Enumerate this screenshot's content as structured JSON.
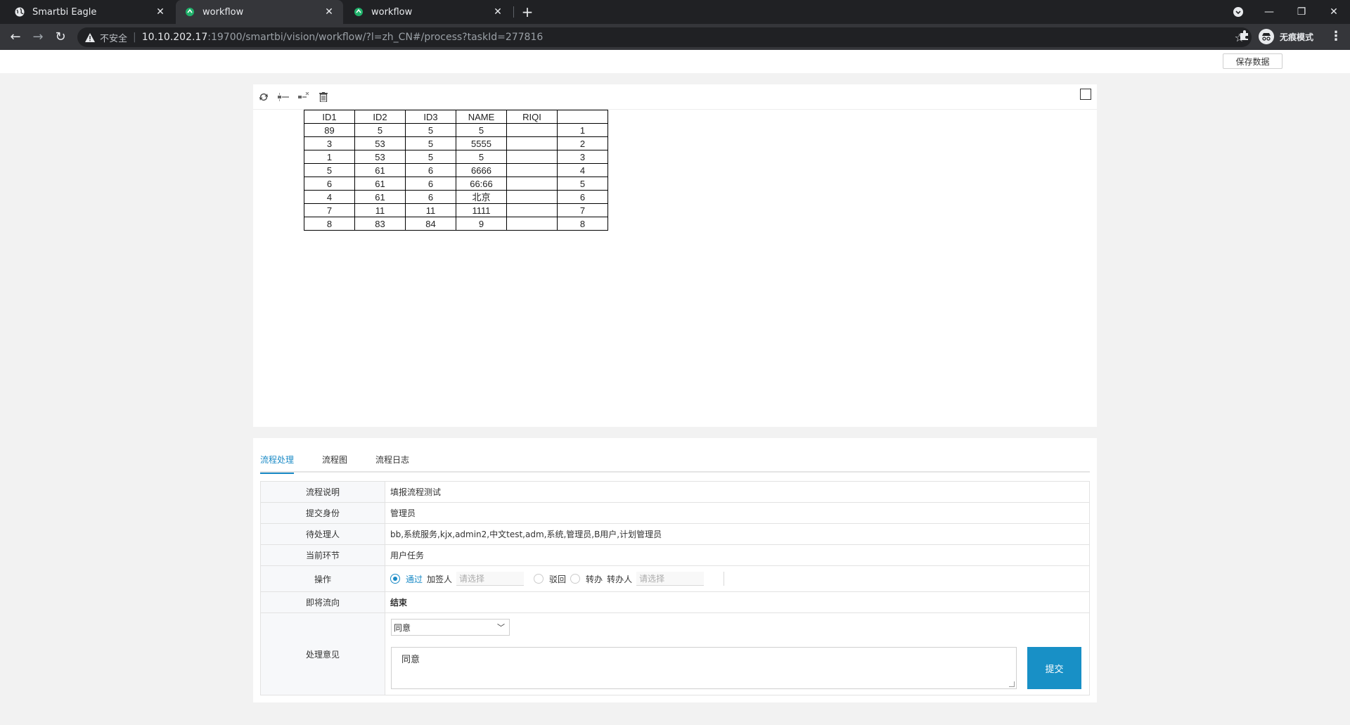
{
  "browser": {
    "tabs": [
      {
        "title": "Smartbi Eagle",
        "active": false
      },
      {
        "title": "workflow",
        "active": true
      },
      {
        "title": "workflow",
        "active": false
      }
    ],
    "new_tab": "+",
    "insecure_label": "不安全",
    "url_host": "10.10.202.17",
    "url_path": ":19700/smartbi/vision/workflow/?l=zh_CN#/process?taskId=277816",
    "profile_label": "无痕模式"
  },
  "page": {
    "save_button": "保存数据"
  },
  "report": {
    "headers": [
      "ID1",
      "ID2",
      "ID3",
      "NAME",
      "RIQI",
      ""
    ],
    "rows": [
      [
        "89",
        "5",
        "5",
        "5",
        "",
        "1"
      ],
      [
        "3",
        "53",
        "5",
        "5555",
        "",
        "2"
      ],
      [
        "1",
        "53",
        "5",
        "5",
        "",
        "3"
      ],
      [
        "5",
        "61",
        "6",
        "6666",
        "",
        "4"
      ],
      [
        "6",
        "61",
        "6",
        "66:66",
        "",
        "5"
      ],
      [
        "4",
        "61",
        "6",
        "北京",
        "",
        "6"
      ],
      [
        "7",
        "11",
        "11",
        "1111",
        "",
        "7"
      ],
      [
        "8",
        "83",
        "84",
        "9",
        "",
        "8"
      ]
    ]
  },
  "workflow": {
    "tabs": [
      "流程处理",
      "流程图",
      "流程日志"
    ],
    "active_tab": "流程处理",
    "fields": {
      "desc_label": "流程说明",
      "desc_value": "填报流程测试",
      "identity_label": "提交身份",
      "identity_value": "管理员",
      "pending_label": "待处理人",
      "pending_value": "bb,系统服务,kjx,admin2,中文test,adm,系统,管理员,B用户,计划管理员",
      "stage_label": "当前环节",
      "stage_value": "用户任务",
      "op_label": "操作",
      "next_label": "即将流向",
      "next_value": "结束",
      "opinion_label": "处理意见"
    },
    "operation": {
      "pass": "通过",
      "add_signer": "加签人",
      "add_signer_placeholder": "请选择",
      "reject": "驳回",
      "transfer": "转办",
      "transfer_to": "转办人",
      "transfer_placeholder": "请选择"
    },
    "opinion_select": "同意",
    "opinion_text": "同意",
    "submit": "提交"
  },
  "colors": {
    "accent": "#1a8ac6",
    "submit_bg": "#1890c6"
  }
}
